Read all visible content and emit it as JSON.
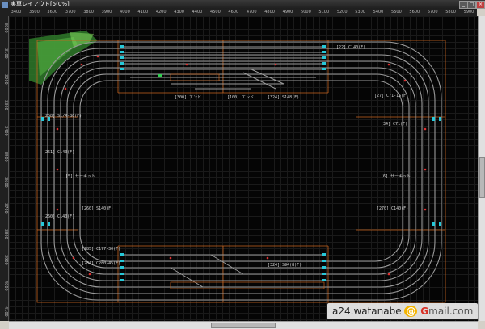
{
  "window": {
    "title": "実車レイアウト[5(0%]",
    "minimize_glyph": "_",
    "maximize_glyph": "□",
    "close_glyph": "×"
  },
  "ruler_top": [
    "3400",
    "3500",
    "3600",
    "3700",
    "3800",
    "3900",
    "4000",
    "4100",
    "4200",
    "4300",
    "4400",
    "4500",
    "4600",
    "4700",
    "4800",
    "4900",
    "5000",
    "5100",
    "5200",
    "5300",
    "5400",
    "5500",
    "5600",
    "5700",
    "5800",
    "5900"
  ],
  "ruler_left": [
    "3000",
    "3100",
    "3200",
    "3300",
    "3400",
    "3500",
    "3600",
    "3700",
    "3800",
    "3900",
    "4000",
    "4100"
  ],
  "track_labels": {
    "left_side": [
      "[258] S1/R-80(F)",
      "[261] C140(F)",
      "[5] サーキット",
      "[260] S140(F)",
      "[260] C140(F)"
    ],
    "right_side": [
      "[22] C140(F)",
      "[27] C71-15(F)",
      "[34] C71(F)",
      "[6] サーキット",
      "[270] C140(F)"
    ],
    "top_center": [
      "[300] エンド",
      "[100] エンド",
      "[324] S148(F)"
    ],
    "bottom_center": [
      "[324] S94(8)F)",
      "[285] C177-30(F)",
      "[284] C280-45(F)"
    ]
  },
  "watermark": {
    "user": "a24.watanabe",
    "at": "@",
    "brand_first": "G",
    "brand_rest": "mail",
    "tld": ".com"
  }
}
